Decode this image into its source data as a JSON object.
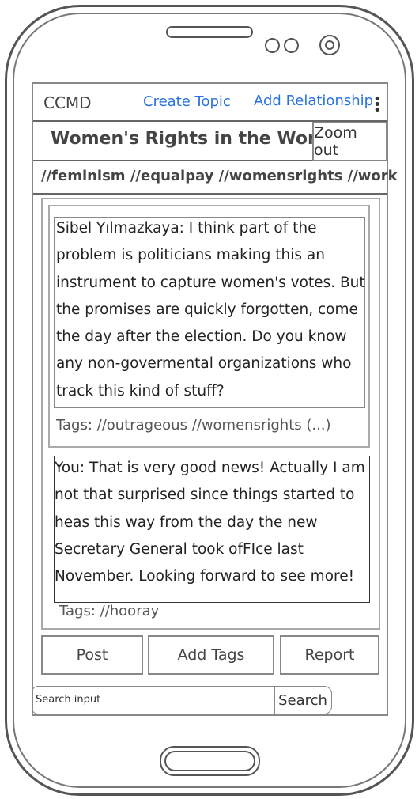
{
  "header": {
    "app_name": "CCMD",
    "create_topic": "Create Topic",
    "add_relationship": "Add Relationship",
    "menu_icon": "kebab-menu-icon"
  },
  "topic": {
    "title": "Women's Rights in the Workplace",
    "zoom_label": "Zoom out",
    "tags": "//feminism //equalpay //womensrights //work"
  },
  "messages": [
    {
      "text": "Sibel Yılmazkaya: I think part of the problem is politicians making this an instrument to capture women's votes. But the promises are quickly forgotten, come the day after the election. Do you know any non-govermental organizations who track this kind of stuff?",
      "tags": "Tags: //outrageous //womensrights (...)"
    },
    {
      "text": "You: That is very good news! Actually I am not that surprised since things started to heas this way from the day the new Secretary General took ofFIce last November. Looking forward to see more!",
      "tags": "Tags: //hooray"
    }
  ],
  "actions": {
    "post": "Post",
    "add_tags": "Add Tags",
    "report": "Report"
  },
  "search": {
    "placeholder": "Search input",
    "button": "Search"
  },
  "colors": {
    "link": "#2a72e0",
    "frame": "#555555"
  }
}
